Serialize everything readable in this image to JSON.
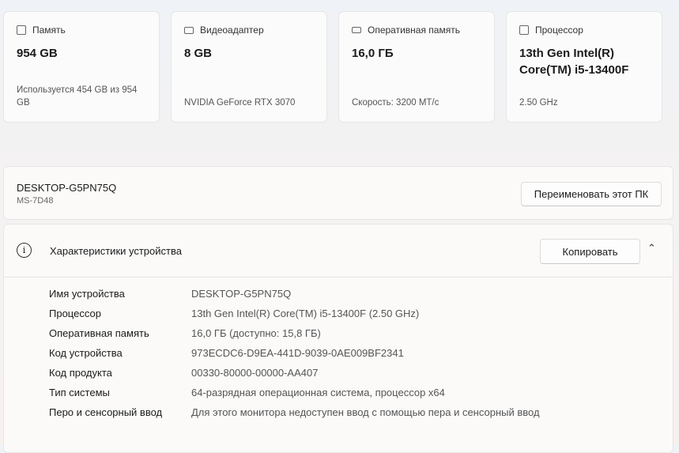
{
  "cards": [
    {
      "icon": "hard-drive-icon",
      "title": "Память",
      "value": "954 GB",
      "sub": "Используется 454 GB из 954 GB"
    },
    {
      "icon": "gpu-icon",
      "title": "Видеоадаптер",
      "value": "8 GB",
      "sub": "NVIDIA GeForce RTX 3070"
    },
    {
      "icon": "ram-icon",
      "title": "Оперативная память",
      "value": "16,0 ГБ",
      "sub": "Скорость: 3200 МТ/с"
    },
    {
      "icon": "cpu-icon",
      "title": "Процессор",
      "value": "13th Gen Intel(R) Core(TM) i5-13400F",
      "sub": "2.50 GHz"
    }
  ],
  "pc": {
    "name": "DESKTOP-G5PN75Q",
    "model": "MS-7D48",
    "rename_label": "Переименовать этот ПК"
  },
  "specs": {
    "title": "Характеристики устройства",
    "copy_label": "Копировать",
    "rows": [
      {
        "k": "Имя устройства",
        "v": "DESKTOP-G5PN75Q"
      },
      {
        "k": "Процессор",
        "v": "13th Gen Intel(R) Core(TM) i5-13400F (2.50 GHz)"
      },
      {
        "k": "Оперативная память",
        "v": "16,0 ГБ (доступно: 15,8 ГБ)"
      },
      {
        "k": "Код устройства",
        "v": "973ECDC6-D9EA-441D-9039-0AE009BF2341"
      },
      {
        "k": "Код продукта",
        "v": "00330-80000-00000-AA407"
      },
      {
        "k": "Тип системы",
        "v": "64-разрядная операционная система, процессор x64"
      },
      {
        "k": "Перо и сенсорный ввод",
        "v": "Для этого монитора недоступен ввод с помощью пера и сенсорный ввод"
      }
    ]
  }
}
